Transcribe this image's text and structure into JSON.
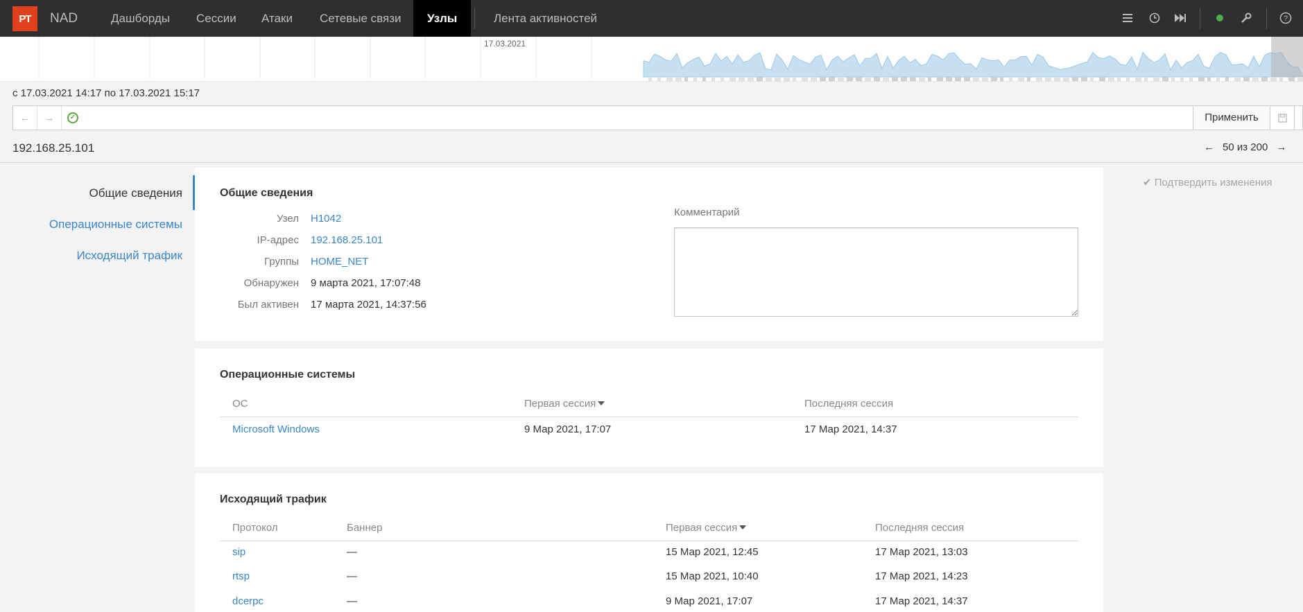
{
  "app": {
    "logo": "PT",
    "product": "NAD"
  },
  "nav": {
    "items": [
      {
        "label": "Дашборды"
      },
      {
        "label": "Сессии"
      },
      {
        "label": "Атаки"
      },
      {
        "label": "Сетевые связи"
      },
      {
        "label": "Узлы",
        "active": true
      },
      {
        "label": "Лента активностей"
      }
    ],
    "icons": [
      "list-icon",
      "clock-icon",
      "fast-forward-icon",
      "status-dot-icon",
      "wrench-icon",
      "help-icon"
    ],
    "status_color": "#4caf50"
  },
  "timeline": {
    "date_label": "17.03.2021"
  },
  "range_text": "с 17.03.2021 14:17 по 17.03.2021 15:17",
  "filter": {
    "apply_label": "Применить",
    "back_icon": "←",
    "forward_icon": "→"
  },
  "host": {
    "title": "192.168.25.101"
  },
  "pager": {
    "prev": "←",
    "text": "50 из 200",
    "next": "→"
  },
  "sidenav": {
    "items": [
      {
        "label": "Общие сведения",
        "active": true
      },
      {
        "label": "Операционные системы"
      },
      {
        "label": "Исходящий трафик"
      }
    ]
  },
  "confirm": {
    "label": "Подтвердить изменения",
    "icon": "✔"
  },
  "general": {
    "title": "Общие сведения",
    "fields": [
      {
        "label": "Узел",
        "value": "H1042",
        "link": true
      },
      {
        "label": "IP-адрес",
        "value": "192.168.25.101",
        "link": true
      },
      {
        "label": "Группы",
        "value": "HOME_NET",
        "link": true
      },
      {
        "label": "Обнаружен",
        "value": "9 марта 2021, 17:07:48",
        "link": false
      },
      {
        "label": "Был активен",
        "value": "17 марта 2021, 14:37:56",
        "link": false
      }
    ],
    "comment_label": "Комментарий",
    "comment_value": ""
  },
  "os": {
    "title": "Операционные системы",
    "columns": [
      "ОС",
      "Первая сессия",
      "Последняя сессия"
    ],
    "rows": [
      {
        "os": "Microsoft Windows",
        "first": "9 Мар 2021, 17:07",
        "last": "17 Мар 2021, 14:37"
      }
    ]
  },
  "traffic": {
    "title": "Исходящий трафик",
    "columns": [
      "Протокол",
      "Баннер",
      "Первая сессия",
      "Последняя сессия"
    ],
    "rows": [
      {
        "proto": "sip",
        "banner": "—",
        "first": "15 Мар 2021, 12:45",
        "last": "17 Мар 2021, 13:03"
      },
      {
        "proto": "rtsp",
        "banner": "—",
        "first": "15 Мар 2021, 10:40",
        "last": "17 Мар 2021, 14:23"
      },
      {
        "proto": "dcerpc",
        "banner": "—",
        "first": "9 Мар 2021, 17:07",
        "last": "17 Мар 2021, 14:37"
      }
    ]
  }
}
